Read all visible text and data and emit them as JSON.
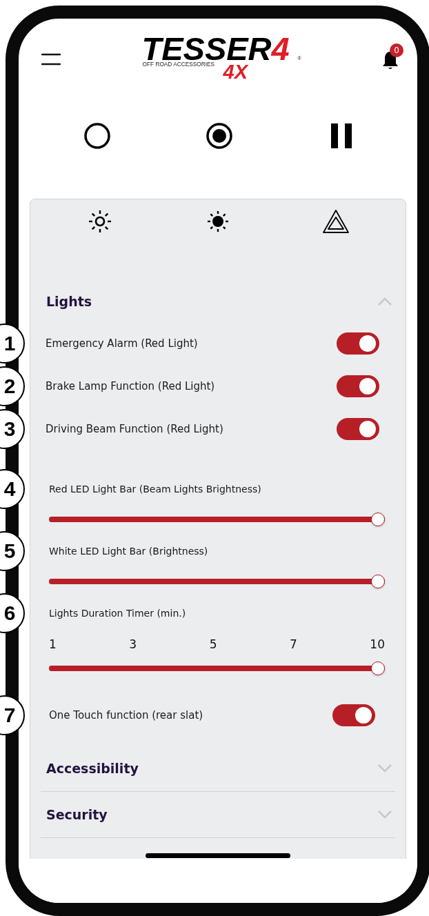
{
  "header": {
    "logo": {
      "word": "TESSER",
      "mark": "4",
      "tagline": "OFF ROAD ACCESSORIES",
      "badge": "4X",
      "registered": "®"
    },
    "notifications": {
      "count": "0"
    }
  },
  "mode_buttons": [
    {
      "kind": "ring"
    },
    {
      "kind": "dot"
    },
    {
      "kind": "pause"
    }
  ],
  "tabs": [
    {
      "kind": "sun-outline"
    },
    {
      "kind": "sun-filled"
    },
    {
      "kind": "hazard"
    }
  ],
  "sections": [
    {
      "title": "Lights",
      "expanded": true,
      "items": [
        {
          "kind": "toggle",
          "label": "Emergency Alarm (Red Light)",
          "on": true,
          "callout": "1"
        },
        {
          "kind": "toggle",
          "label": "Brake Lamp Function (Red Light)",
          "on": true,
          "callout": "2"
        },
        {
          "kind": "toggle",
          "label": "Driving Beam Function (Red Light)",
          "on": true,
          "callout": "3"
        },
        {
          "kind": "slider",
          "label": "Red LED Light Bar (Beam Lights Brightness)",
          "level": 1,
          "callout": "4"
        },
        {
          "kind": "slider",
          "label": "White LED Light Bar (Brightness)",
          "level": 1,
          "callout": "5"
        },
        {
          "kind": "slider",
          "label": "Lights Duration Timer (min.)",
          "ticks": [
            "1",
            "3",
            "5",
            "7",
            "10"
          ],
          "level": 1,
          "callout": "6"
        },
        {
          "kind": "toggle",
          "label": "One Touch function (rear slat)",
          "on": true,
          "callout": "7"
        }
      ]
    },
    {
      "title": "Accessibility",
      "expanded": false
    },
    {
      "title": "Security",
      "expanded": false
    }
  ]
}
